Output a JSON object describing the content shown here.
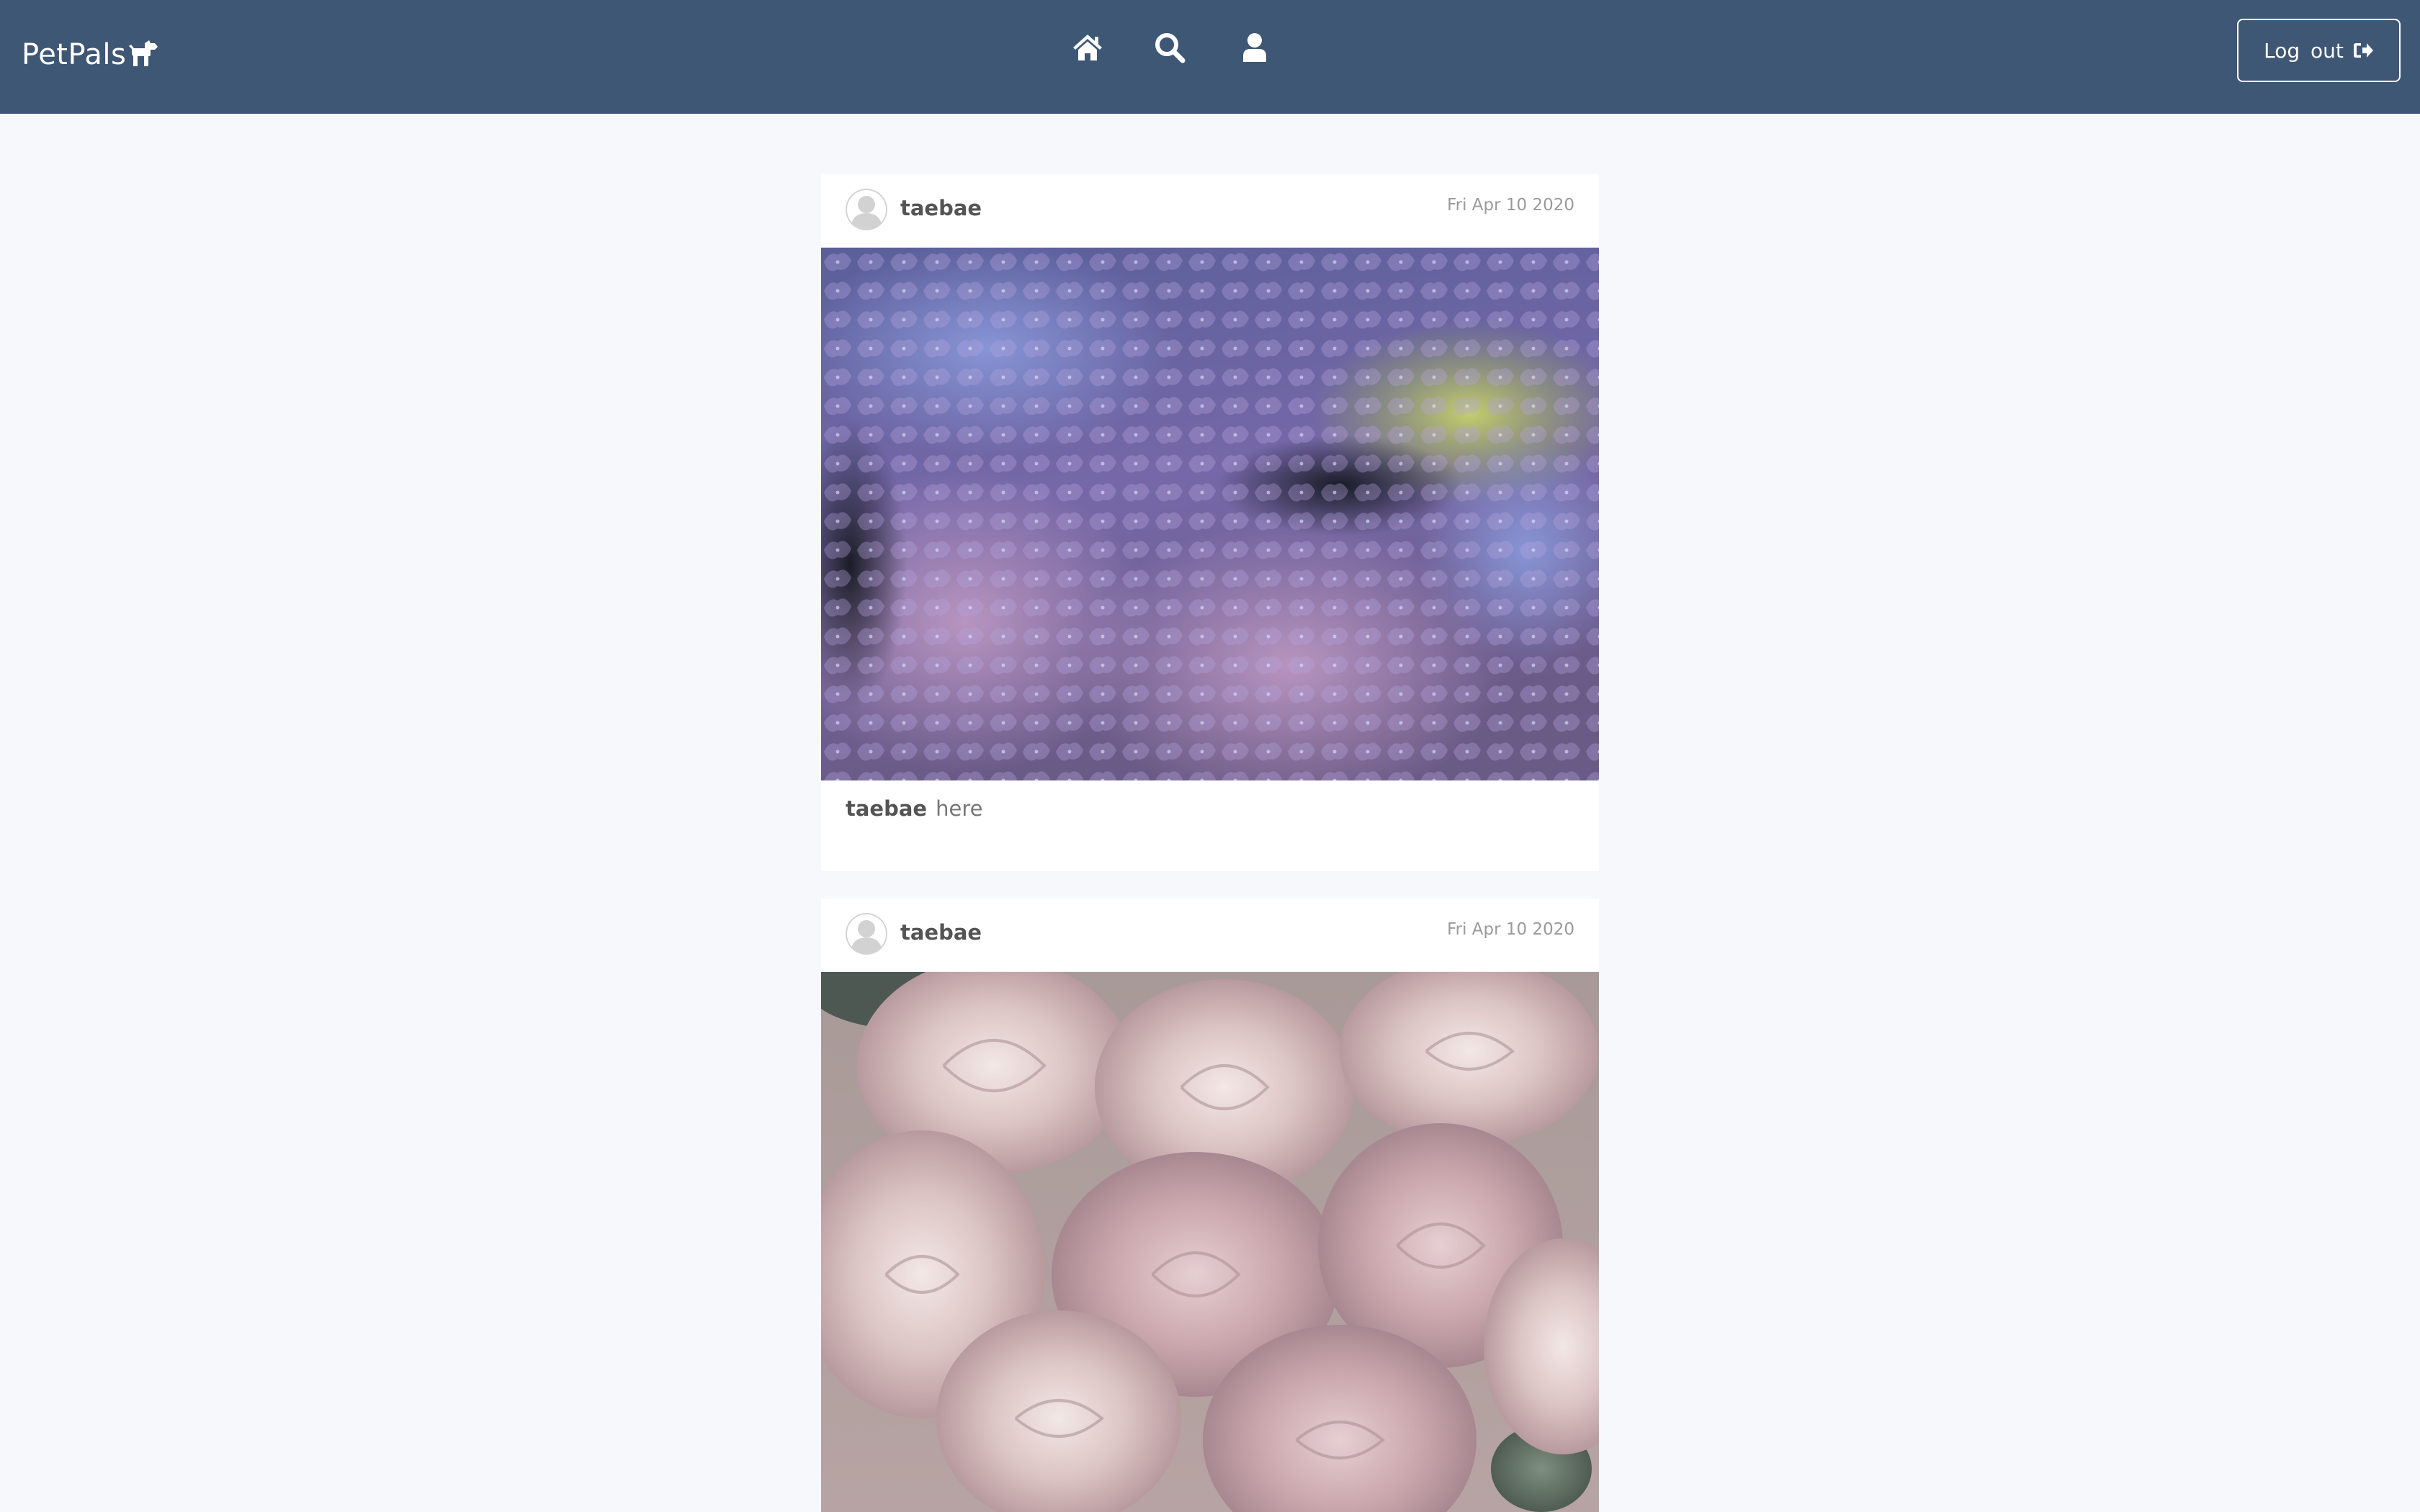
{
  "navbar": {
    "brand": "PetPals",
    "nav_icons": [
      "home-icon",
      "search-icon",
      "user-icon"
    ],
    "logout_label": "Log out",
    "logout_icon": "sign-out-icon",
    "bg_color": "#3e5774"
  },
  "feed": {
    "posts": [
      {
        "username": "taebae",
        "date": "Fri Apr 10 2020",
        "photo": "purple-blue-hydrangea-flowers",
        "caption_user": "taebae",
        "caption_text": "here"
      },
      {
        "username": "taebae",
        "date": "Fri Apr 10 2020",
        "photo": "pale-pink-ranunculus-flowers"
      }
    ]
  }
}
